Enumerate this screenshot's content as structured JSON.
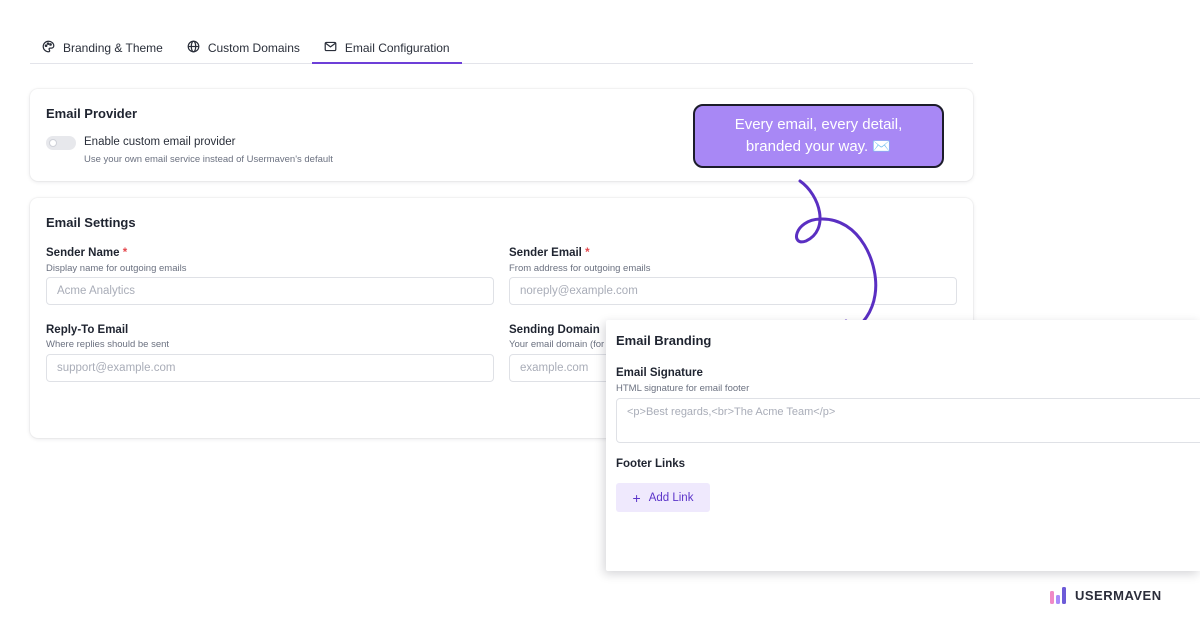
{
  "tabs": [
    {
      "label": "Branding & Theme",
      "icon": "palette-icon"
    },
    {
      "label": "Custom Domains",
      "icon": "globe-icon"
    },
    {
      "label": "Email Configuration",
      "icon": "mail-icon",
      "active": true
    }
  ],
  "provider": {
    "title": "Email Provider",
    "toggle_label": "Enable custom email provider",
    "toggle_desc": "Use your own email service instead of Usermaven's default",
    "enabled": false
  },
  "settings": {
    "title": "Email Settings",
    "sender_name": {
      "label": "Sender Name",
      "required": "*",
      "help": "Display name for outgoing emails",
      "placeholder": "Acme Analytics"
    },
    "sender_email": {
      "label": "Sender Email",
      "required": "*",
      "help": "From address for outgoing emails",
      "placeholder": "noreply@example.com"
    },
    "reply_to": {
      "label": "Reply-To Email",
      "help": "Where replies should be sent",
      "placeholder": "support@example.com"
    },
    "sending_domain": {
      "label": "Sending Domain",
      "help": "Your email domain (for",
      "placeholder": "example.com"
    }
  },
  "callout": {
    "text": "Every email, every detail, branded your way. ✉️"
  },
  "branding": {
    "title": "Email Branding",
    "signature_label": "Email Signature",
    "signature_help": "HTML signature for email footer",
    "signature_placeholder": "<p>Best regards,<br>The Acme Team</p>",
    "footer_links_label": "Footer Links",
    "add_link_label": "Add Link"
  },
  "logo": {
    "text": "USERMAVEN"
  },
  "colors": {
    "accent": "#6d3fd8",
    "callout_bg": "#a888f5",
    "required": "#e5484d"
  }
}
